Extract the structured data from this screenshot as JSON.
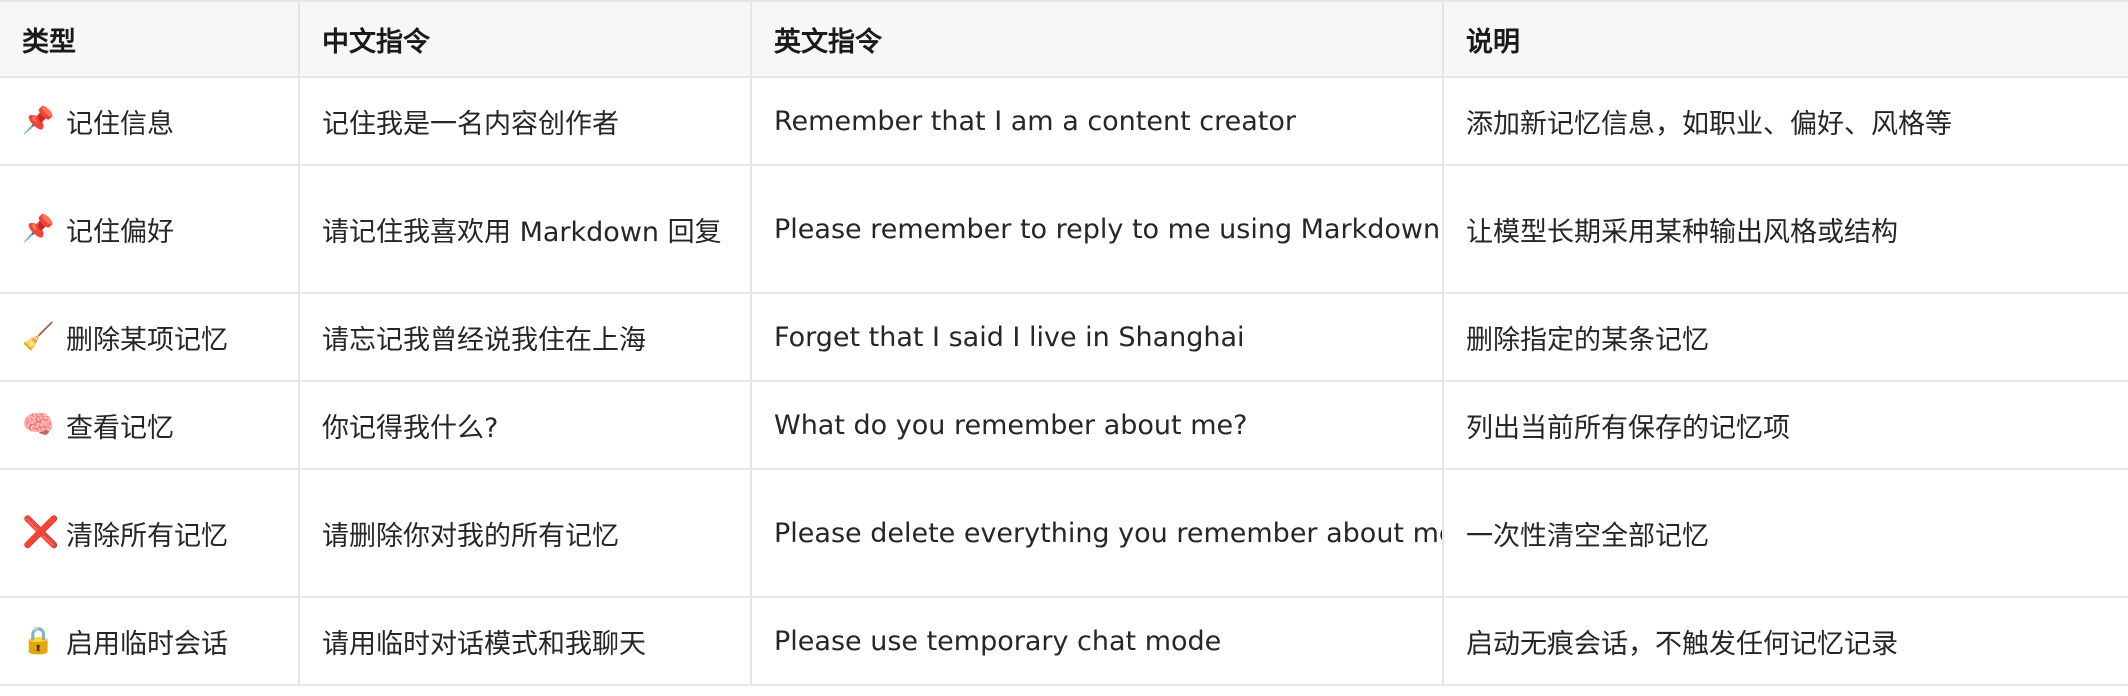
{
  "table": {
    "headers": [
      "类型",
      "中文指令",
      "英文指令",
      "说明"
    ],
    "rows": [
      {
        "icon": "pushpin-icon",
        "glyph": "📌",
        "type": "记住信息",
        "zh": "记住我是一名内容创作者",
        "en": "Remember that I am a content creator",
        "desc": "添加新记忆信息，如职业、偏好、风格等"
      },
      {
        "icon": "pushpin-icon",
        "glyph": "📌",
        "type": "记住偏好",
        "zh": "请记住我喜欢用 Markdown 回复",
        "en": "Please remember to reply to me using Markdown",
        "desc": "让模型长期采用某种输出风格或结构"
      },
      {
        "icon": "broom-icon",
        "glyph": "🧹",
        "type": "删除某项记忆",
        "zh": "请忘记我曾经说我住在上海",
        "en": "Forget that I said I live in Shanghai",
        "desc": "删除指定的某条记忆"
      },
      {
        "icon": "brain-icon",
        "glyph": "🧠",
        "type": "查看记忆",
        "zh": "你记得我什么?",
        "en": "What do you remember about me?",
        "desc": "列出当前所有保存的记忆项"
      },
      {
        "icon": "cross-mark-icon",
        "glyph": "❌",
        "type": "清除所有记忆",
        "zh": "请删除你对我的所有记忆",
        "en": "Please delete everything you remember about me",
        "desc": "一次性清空全部记忆"
      },
      {
        "icon": "lock-icon",
        "glyph": "🔒",
        "type": "启用临时会话",
        "zh": "请用临时对话模式和我聊天",
        "en": "Please use temporary chat mode",
        "desc": "启动无痕会话，不触发任何记忆记录"
      }
    ]
  }
}
